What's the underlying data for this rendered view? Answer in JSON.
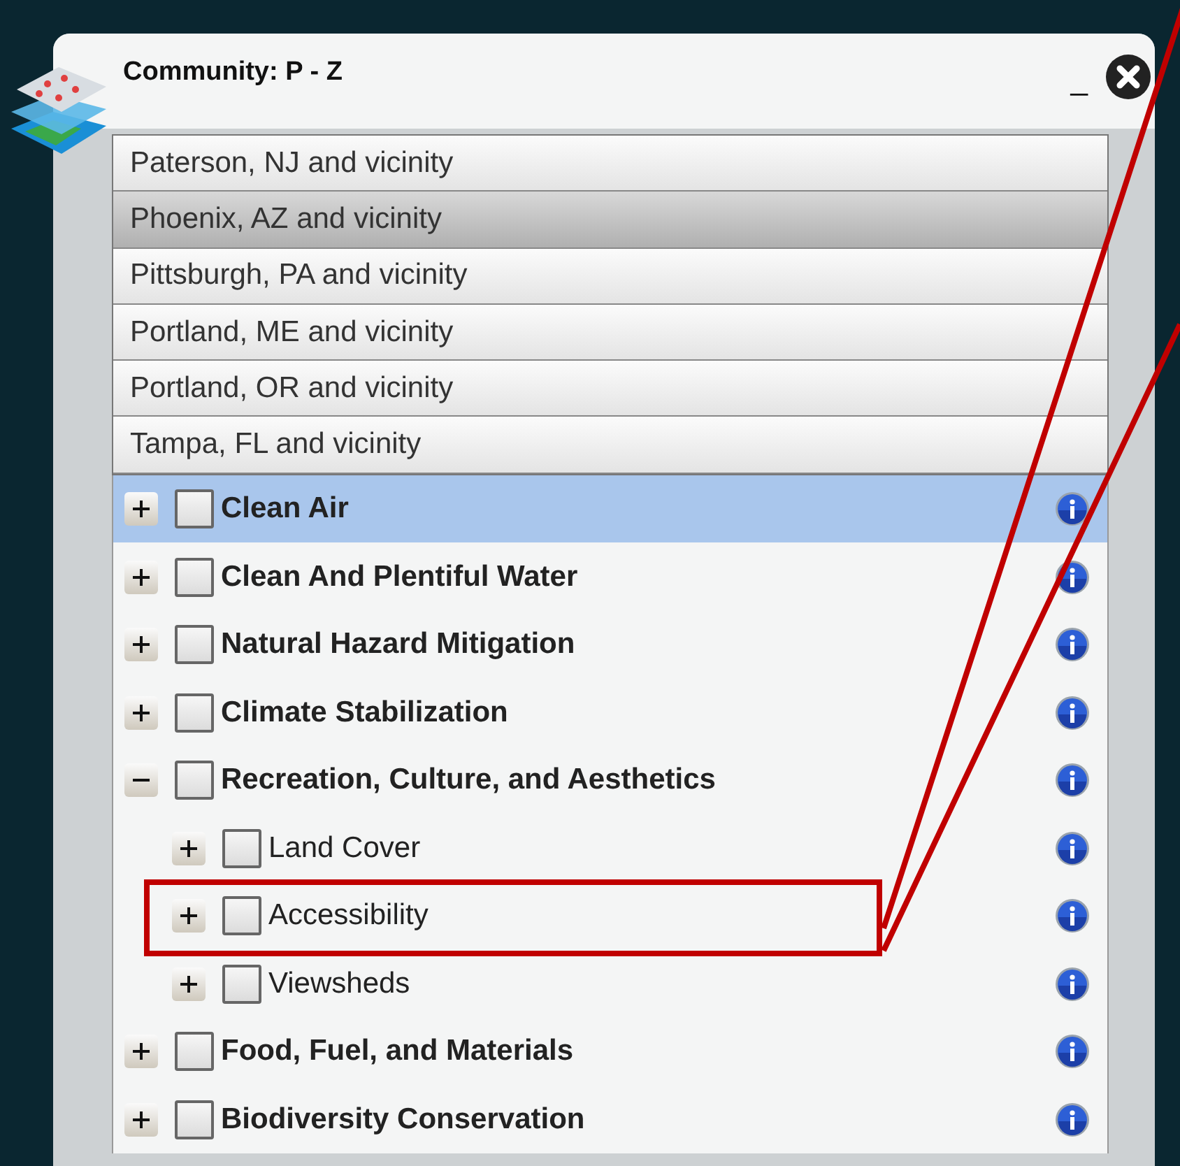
{
  "window": {
    "title": "Community: P - Z",
    "minimize": "_"
  },
  "communities": [
    {
      "label": "Paterson, NJ and vicinity",
      "selected": false
    },
    {
      "label": "Phoenix, AZ and vicinity",
      "selected": true
    },
    {
      "label": "Pittsburgh, PA and vicinity",
      "selected": false
    },
    {
      "label": "Portland, ME and vicinity",
      "selected": false
    },
    {
      "label": "Portland, OR and vicinity",
      "selected": false
    },
    {
      "label": "Tampa, FL and vicinity",
      "selected": false
    }
  ],
  "layers": [
    {
      "label": "Clean Air",
      "selected": true,
      "expanded": false,
      "checked": false
    },
    {
      "label": "Clean And Plentiful Water",
      "selected": false,
      "expanded": false,
      "checked": false
    },
    {
      "label": "Natural Hazard Mitigation",
      "selected": false,
      "expanded": false,
      "checked": false
    },
    {
      "label": "Climate Stabilization",
      "selected": false,
      "expanded": false,
      "checked": false
    },
    {
      "label": "Recreation, Culture, and Aesthetics",
      "selected": false,
      "expanded": true,
      "checked": false,
      "children": [
        {
          "label": "Land Cover",
          "selected": false,
          "expanded": false,
          "checked": false,
          "annotated": false
        },
        {
          "label": "Accessibility",
          "selected": false,
          "expanded": false,
          "checked": false,
          "annotated": true
        },
        {
          "label": "Viewsheds",
          "selected": false,
          "expanded": false,
          "checked": false,
          "annotated": false
        }
      ]
    },
    {
      "label": "Food, Fuel, and Materials",
      "selected": false,
      "expanded": false,
      "checked": false
    },
    {
      "label": "Biodiversity Conservation",
      "selected": false,
      "expanded": false,
      "checked": false
    }
  ]
}
